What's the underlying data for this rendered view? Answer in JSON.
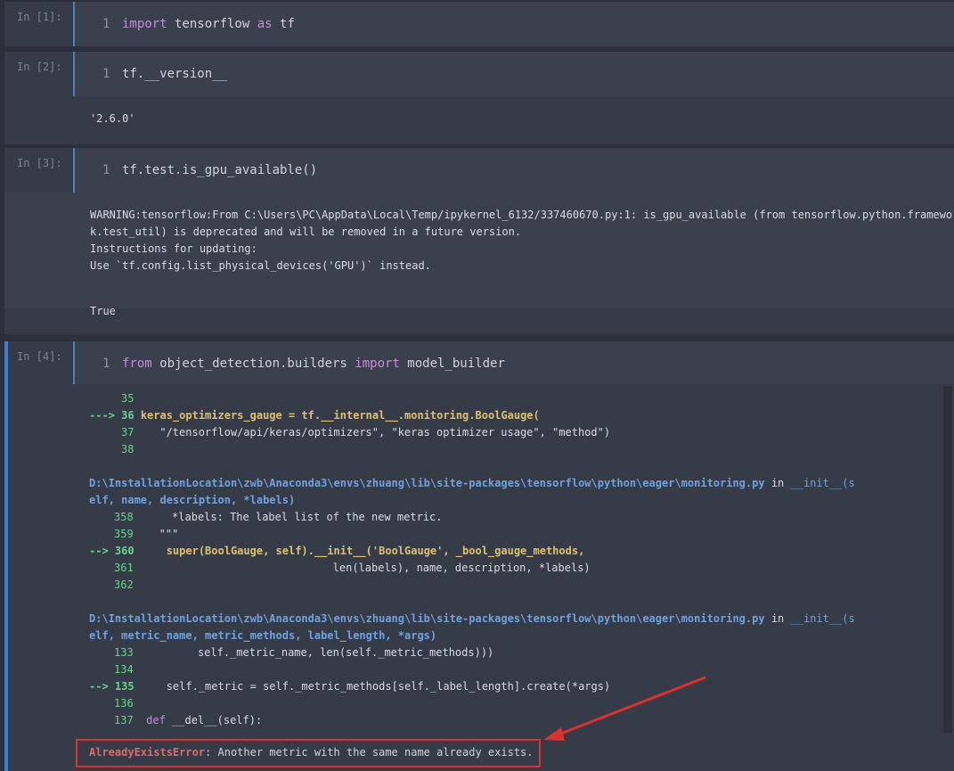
{
  "cells": [
    {
      "prompt": "In  [1]:",
      "lineno": "1",
      "code_kw1": "import",
      "code_mid": " tensorflow ",
      "code_kw2": "as",
      "code_end": " tf"
    },
    {
      "prompt": "In  [2]:",
      "lineno": "1",
      "code": "tf.__version__",
      "output": "'2.6.0'"
    },
    {
      "prompt": "In  [3]:",
      "lineno": "1",
      "code": "tf.test.is_gpu_available()",
      "warning": [
        "WARNING:tensorflow:From C:\\Users\\PC\\AppData\\Local\\Temp/ipykernel_6132/337460670.py:1: is_gpu_available (from tensorflow.python.framewor",
        "k.test_util) is deprecated and will be removed in a future version.",
        "Instructions for updating:",
        "Use `tf.config.list_physical_devices('GPU')` instead."
      ],
      "output": "True"
    },
    {
      "prompt": "In  [4]:",
      "lineno": "1",
      "code_kw1": "from",
      "code_mid": " object_detection.builders ",
      "code_kw2": "import",
      "code_end": " model_builder"
    }
  ],
  "traceback": {
    "l35": "35",
    "arrow36": "---> 36",
    "code36": "keras_optimizers_gauge = tf.__internal__.monitoring.BoolGauge(",
    "l37": "37",
    "code37": "\"/tensorflow/api/keras/optimizers\", \"keras optimizer usage\", \"method\")",
    "l38": "38",
    "path1": "D:\\InstallationLocation\\zwb\\Anaconda3\\envs\\zhuang\\lib\\site-packages\\tensorflow\\python\\eager\\monitoring.py",
    "in1": " in ",
    "fn1a": "__init__(s",
    "fn1b": "elf, name, description, *labels)",
    "l358": "358",
    "code358": "*labels: The label list of the new metric.",
    "l359": "359",
    "code359": "\"\"\"",
    "arrow360": "--> 360",
    "code360": "super(BoolGauge, self).__init__('BoolGauge', _bool_gauge_methods,",
    "l361": "361",
    "code361": "len(labels), name, description, *labels)",
    "l362": "362",
    "path2": "D:\\InstallationLocation\\zwb\\Anaconda3\\envs\\zhuang\\lib\\site-packages\\tensorflow\\python\\eager\\monitoring.py",
    "in2": " in ",
    "fn2a": "__init__(s",
    "fn2b": "elf, metric_name, metric_methods, label_length, *args)",
    "l133": "133",
    "code133": "self._metric_name, len(self._metric_methods)))",
    "l134": "134",
    "arrow135": "--> 135",
    "code135": "self._metric = self._metric_methods[self._label_length].create(*args)",
    "l136": "136",
    "l137": "137",
    "code137_kw": "def",
    "code137": " __del__(self):",
    "error_name": "AlreadyExistsError",
    "error_msg": ": Another metric with the same name already exists."
  },
  "colors": {
    "accent": "#3a7bd5",
    "annotation": "#e0302a"
  }
}
